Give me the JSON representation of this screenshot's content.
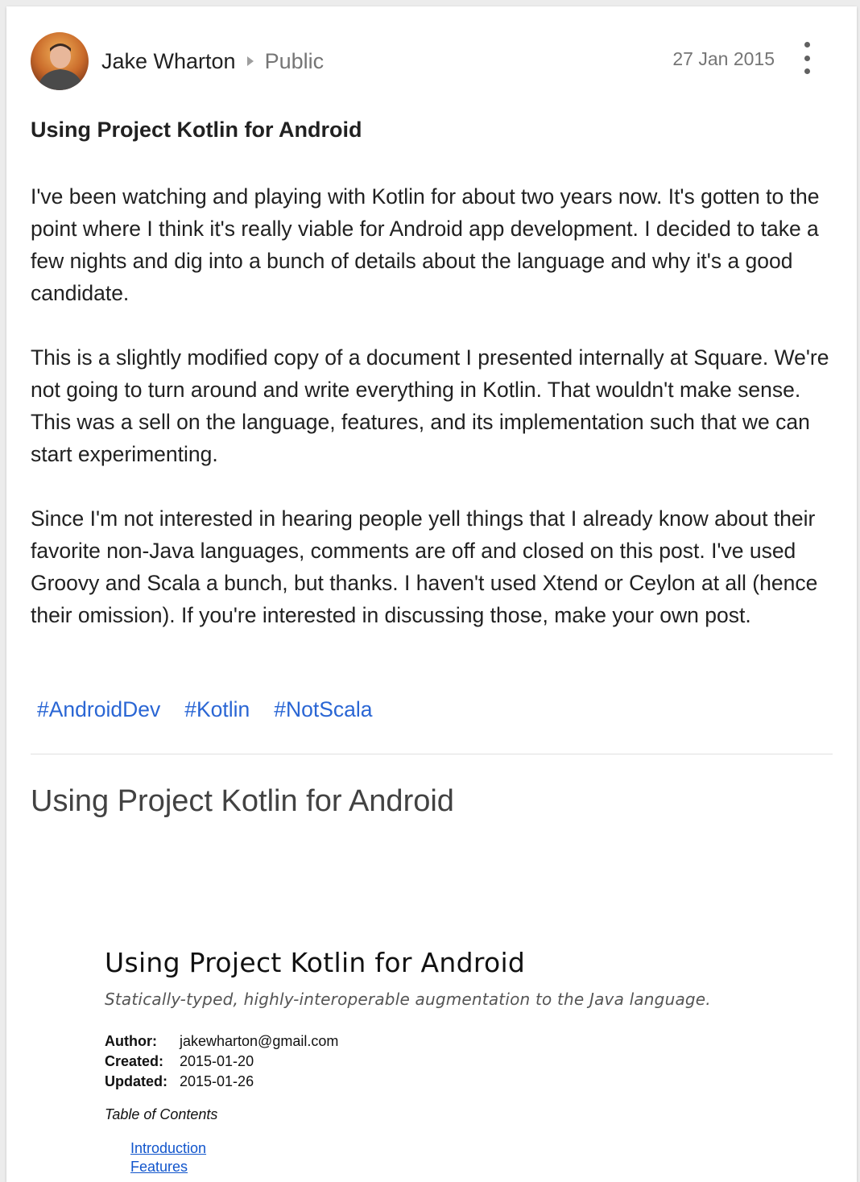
{
  "post": {
    "author": "Jake Wharton",
    "audience": "Public",
    "date": "27 Jan 2015",
    "title": "Using Project Kotlin for Android",
    "paragraphs": [
      "I've been watching and playing with Kotlin for about two years now. It's gotten to the point where I think it's really viable for Android app development. I decided to take a few nights and dig into a bunch of details about the language and why it's a good candidate.",
      "This is a slightly modified copy of a document I presented internally at Square. We're not going to turn around and write everything in Kotlin. That wouldn't make sense. This was a sell on the language, features, and its implementation such that we can start experimenting.",
      "Since I'm not interested in hearing people yell things that I already know about their favorite non-Java languages, comments are off and closed on this post. I've used Groovy and Scala a bunch, but thanks. I haven't used Xtend or Ceylon at all (hence their omission). If you're interested in discussing those, make your own post."
    ],
    "hashtags": [
      "#AndroidDev",
      "#Kotlin",
      "#NotScala"
    ]
  },
  "link": {
    "title": "Using Project Kotlin for Android"
  },
  "doc": {
    "title": "Using Project Kotlin for Android",
    "subtitle": "Statically-typed, highly-interoperable augmentation to the Java language.",
    "meta": [
      {
        "label": "Author:",
        "value": "jakewharton@gmail.com"
      },
      {
        "label": "Created:",
        "value": "2015-01-20"
      },
      {
        "label": "Updated:",
        "value": "2015-01-26"
      }
    ],
    "toc_title": "Table of Contents",
    "toc": [
      "Introduction",
      "Features"
    ]
  },
  "icons": {
    "more": "more-vert-icon",
    "caret": "caret-right-icon"
  },
  "colors": {
    "hashtag": "#2a66d4",
    "toc_link": "#1155cc"
  }
}
